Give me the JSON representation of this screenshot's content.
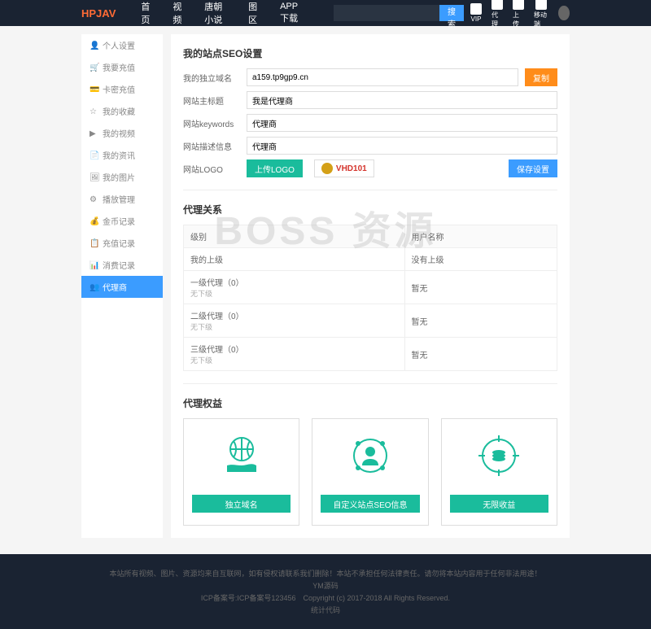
{
  "header": {
    "logo": "HPJAV",
    "nav": [
      "首页",
      "视频",
      "唐朝小说",
      "图区",
      "APP下载"
    ],
    "search_btn": "搜索",
    "icons": [
      {
        "label": "VIP"
      },
      {
        "label": "代理"
      },
      {
        "label": "上传"
      },
      {
        "label": "移动端"
      }
    ]
  },
  "sidebar": {
    "items": [
      "个人设置",
      "我要充值",
      "卡密充值",
      "我的收藏",
      "我的视频",
      "我的资讯",
      "我的图片",
      "播放管理",
      "金币记录",
      "充值记录",
      "消费记录",
      "代理商"
    ]
  },
  "seo": {
    "title": "我的站点SEO设置",
    "rows": {
      "domain_label": "我的独立域名",
      "domain_value": "a159.tp9gp9.cn",
      "copy": "复制",
      "keyword_label": "网站主标题",
      "keyword_value": "我是代理商",
      "keywords_label": "网站keywords",
      "keywords_value": "代理商",
      "desc_label": "网站描述信息",
      "desc_value": "代理商",
      "logo_label": "网站LOGO",
      "upload": "上传LOGO",
      "badge": "VHD101",
      "save": "保存设置"
    }
  },
  "relation": {
    "title": "代理关系",
    "th1": "级别",
    "th2": "用户名称",
    "rows": [
      {
        "level": "我的上级",
        "name": "没有上级",
        "sub": ""
      },
      {
        "level": "一级代理（0）",
        "name": "暂无",
        "sub": "无下级"
      },
      {
        "level": "二级代理（0）",
        "name": "暂无",
        "sub": "无下级"
      },
      {
        "level": "三级代理（0）",
        "name": "暂无",
        "sub": "无下级"
      }
    ]
  },
  "benefits": {
    "title": "代理权益",
    "cards": [
      {
        "btn": "独立域名"
      },
      {
        "btn": "自定义站点SEO信息"
      },
      {
        "btn": "无限收益"
      }
    ]
  },
  "footer": {
    "line1": "本站所有视频、图片、资源均来自互联网，如有侵权请联系我们删除！本站不承担任何法律责任。请勿将本站内容用于任何非法用途！",
    "line2": "YM源码",
    "line3": "ICP备案号:ICP备案号123456　Copyright (c) 2017-2018 All Rights Reserved.",
    "line4": "统计代码"
  },
  "watermark": "BOSS 资源"
}
